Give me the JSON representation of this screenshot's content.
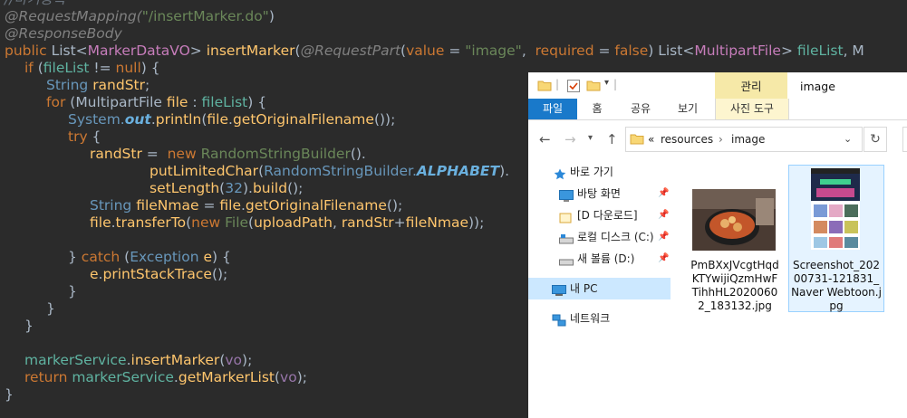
{
  "code": {
    "line0_comment": "//마커등록",
    "line1": [
      "@RequestMapping(",
      "\"/insertMarker.do\"",
      ")"
    ],
    "line2": "@ResponseBody",
    "line3": {
      "public": "public ",
      "list": "List<",
      "vo": "MarkerDataVO",
      "gt": "> ",
      "method": "insertMarker",
      "p1": "(",
      "reqpart": "@RequestPart",
      "p2": "(",
      "value": "value",
      "eq1": " = ",
      "image": "\"image\"",
      "comma": ",  ",
      "required": "required",
      "eq2": " = ",
      "false": "false",
      "p3": ") List<",
      "mpf": "MultipartFile",
      "p4": "> ",
      "fileList": "fileList",
      "p5": ", M"
    },
    "line4": {
      "if": "if ",
      "a": "(",
      "fileList": "fileList",
      "b": " != ",
      "null": "null",
      "c": ") {"
    },
    "line5": {
      "type": "String ",
      "var": "randStr",
      "semi": ";"
    },
    "line6": {
      "for": "for ",
      "a": "(",
      "type": "MultipartFile ",
      "var": "file",
      "b": " : ",
      "list": "fileList",
      "c": ") {"
    },
    "line7": {
      "sys": "System.",
      "out": "out",
      "dot": ".",
      "println": "println",
      "a": "(",
      "file": "file",
      "b": ".",
      "getOF": "getOriginalFilename",
      "c": "());"
    },
    "line8": {
      "try": "try",
      "b": " {"
    },
    "line9": {
      "var": "randStr",
      "eq": " =  ",
      "new": "new ",
      "cls": "RandomStringBuilder",
      "end": "()."
    },
    "line10": {
      "fn": "putLimitedChar",
      "a": "(",
      "cls": "RandomStringBuilder.",
      "alpha": "ALPHABET",
      "b": ")."
    },
    "line11": {
      "fn": "setLength",
      "a": "(",
      "num": "32",
      "b": ").",
      "build": "build",
      "c": "();"
    },
    "line12": {
      "type": "String ",
      "var": "fileNmae",
      "eq": " = ",
      "file": "file",
      "b": ".",
      "fn": "getOriginalFilename",
      "c": "();"
    },
    "line13": {
      "file": "file",
      "b": ".",
      "fn": "transferTo",
      "a": "(",
      "new": "new ",
      "cls": "File",
      "c": "(",
      "up": "uploadPath",
      "d": ", ",
      "rs": "randStr",
      "e": "+",
      "fn2": "fileNmae",
      "f": "));"
    },
    "line15": {
      "a": "} ",
      "catch": "catch ",
      "b": "(",
      "ex": "Exception ",
      "e": "e",
      "c": ") {"
    },
    "line16": {
      "e": "e",
      "b": ".",
      "fn": "printStackTrace",
      "c": "();"
    },
    "line17": "}",
    "line18": "}",
    "line19": "}",
    "line21": {
      "svc": "markerService",
      "b": ".",
      "fn": "insertMarker",
      "a": "(",
      "vo": "vo",
      "c": ");"
    },
    "line22": {
      "ret": "return ",
      "svc": "markerService",
      "b": ".",
      "fn": "getMarkerList",
      "a": "(",
      "vo": "vo",
      "c": ");"
    },
    "line23": "}"
  },
  "explorer": {
    "ribbon_context_tab": "관리",
    "window_title": "image",
    "tabs": [
      "파일",
      "홈",
      "공유",
      "보기",
      "사진 도구"
    ],
    "address": {
      "prefix": "«",
      "parts": [
        "resources",
        "image"
      ],
      "sep": "›"
    },
    "nav": {
      "quick_access": "바로 가기",
      "desktop": "바탕 화면",
      "downloads": "[D 다운로드]",
      "local_disk": "로컬 디스크 (C:)",
      "new_volume": "새 볼륨 (D:)",
      "this_pc": "내 PC",
      "network": "네트워크"
    },
    "files": [
      {
        "name": "PmBXxJVcgtHqdKTYwijiQzmHwFTihhHL20200602_183132.jpg",
        "selected": false
      },
      {
        "name": "Screenshot_20200731-121831_Naver Webtoon.jpg",
        "selected": true
      }
    ]
  },
  "colors": {
    "editor_bg": "#2b2b2b",
    "keyword": "#cc7832",
    "string": "#6a8759",
    "ribbon_file": "#1979ca",
    "context_tab": "#f6e9a8",
    "selection": "#cce8ff"
  }
}
